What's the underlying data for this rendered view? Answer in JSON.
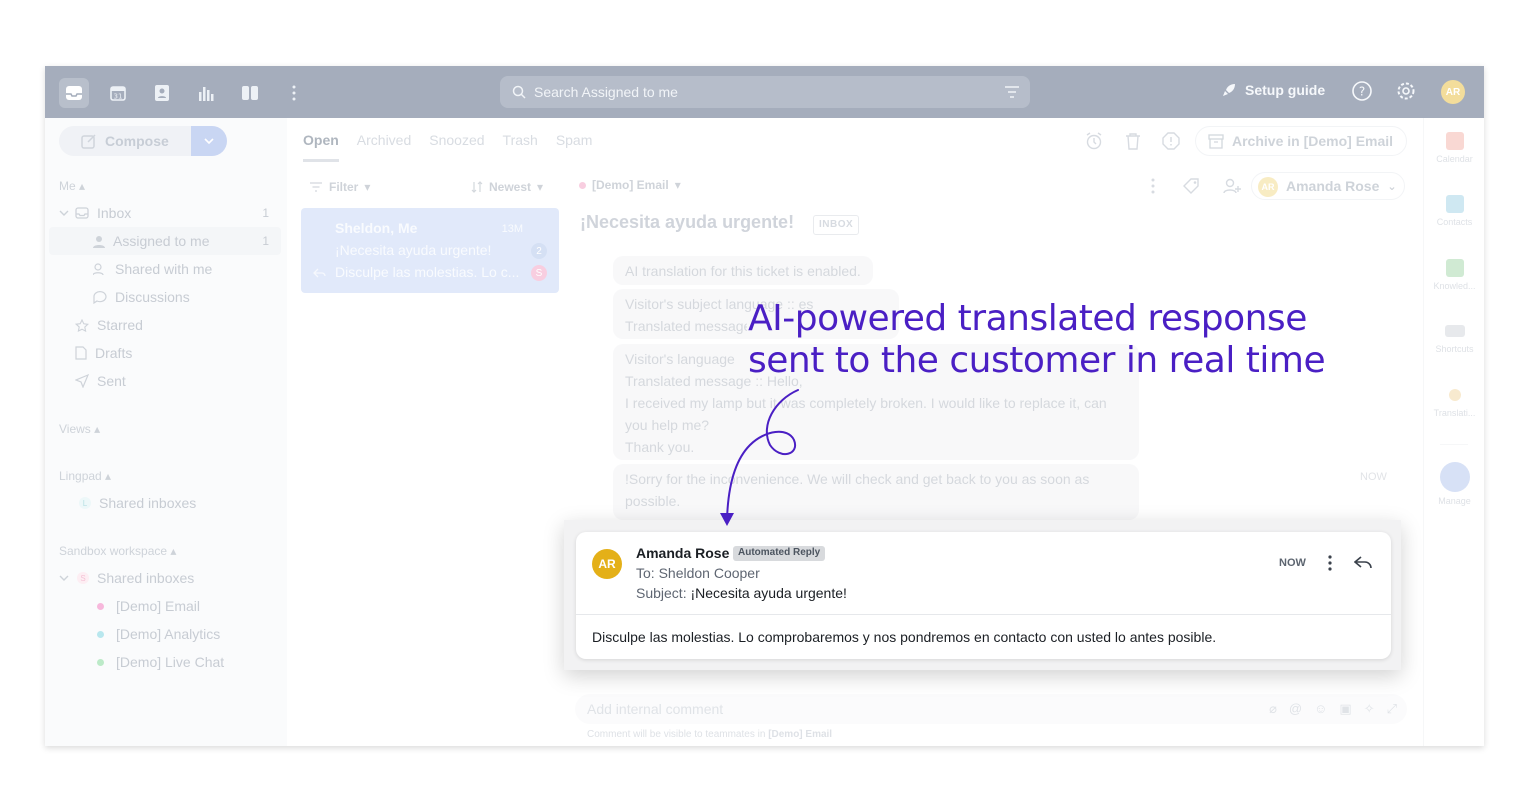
{
  "topbar": {
    "search_placeholder": "Search Assigned to me",
    "setup_label": "Setup guide",
    "avatar_initials": "AR",
    "calendar_day": "31"
  },
  "sidebar": {
    "compose_label": "Compose",
    "me_header": "Me",
    "inbox_label": "Inbox",
    "inbox_count": "1",
    "assigned_label": "Assigned to me",
    "assigned_count": "1",
    "shared_label": "Shared with me",
    "discussions_label": "Discussions",
    "starred_label": "Starred",
    "drafts_label": "Drafts",
    "sent_label": "Sent",
    "views_header": "Views",
    "lingpad_header": "Lingpad",
    "lingpad_shared": "Shared inboxes",
    "lingpad_badge": "L",
    "sandbox_header": "Sandbox workspace",
    "sandbox_shared": "Shared inboxes",
    "sandbox_badge": "S",
    "inboxes": [
      {
        "label": "[Demo] Email",
        "color": "#f07fbf"
      },
      {
        "label": "[Demo] Analytics",
        "color": "#7fd3e0"
      },
      {
        "label": "[Demo] Live Chat",
        "color": "#86d99b"
      }
    ]
  },
  "tabs": [
    "Open",
    "Archived",
    "Snoozed",
    "Trash",
    "Spam"
  ],
  "archive_button": "Archive in [Demo] Email",
  "list": {
    "filter_label": "Filter",
    "sort_label": "Newest",
    "card": {
      "name": "Sheldon, Me",
      "time": "13M",
      "subject": "¡Necesita ayuda urgente!",
      "preview": "Disculpe las molestias. Lo c...",
      "count_badge": "2",
      "initial_badge": "S"
    }
  },
  "thread": {
    "inbox_name": "[Demo] Email",
    "title": "¡Necesita ayuda urgente!",
    "inbox_tag": "INBOX",
    "assignee_name": "Amanda Rose",
    "assignee_initials": "AR",
    "msg_translation_enabled": "AI translation for this ticket is enabled.",
    "msg_subject_lang_1": "Visitor's subject language :: es",
    "msg_subject_lang_2": "Translated message :: Needs urgent help!",
    "msg_lang_1": "Visitor's language :: es",
    "msg_lang_2": "Translated message :: Hello,",
    "msg_lang_3": "I received my lamp but it was completely broken. I would like to replace it, can",
    "msg_lang_4": "you help me?",
    "msg_lang_5": "Thank you.",
    "msg_reply_1": "!Sorry for the inconvenience. We will check and get back to you as soon as",
    "msg_reply_2": "possible.",
    "msg_time": "NOW",
    "comment_placeholder": "Add internal comment",
    "comment_note_prefix": "Comment will be visible to teammates in",
    "comment_note_inbox": "[Demo] Email"
  },
  "rail": [
    {
      "label": "Calendar",
      "color": "#f4b8b0"
    },
    {
      "label": "Contacts",
      "color": "#a8d5e8"
    },
    {
      "label": "Knowled...",
      "color": "#a9d9b0"
    },
    {
      "label": "Shortcuts",
      "color": "#d3d7dd"
    },
    {
      "label": "Translati...",
      "color": "#f3d9a8"
    },
    {
      "label": "Manage",
      "color": "#b7c8ee"
    }
  ],
  "popup": {
    "initials": "AR",
    "from": "Amanda Rose",
    "automated_tag": "Automated Reply",
    "to": "To: Sheldon Cooper",
    "subject_prefix": "Subject:",
    "subject": "¡Necesita ayuda urgente!",
    "time": "NOW",
    "body": "Disculpe las molestias. Lo comprobaremos y nos pondremos en contacto con usted lo antes posible."
  },
  "headline": {
    "line1": "AI-powered translated response",
    "line2": "sent to the customer in real time"
  }
}
